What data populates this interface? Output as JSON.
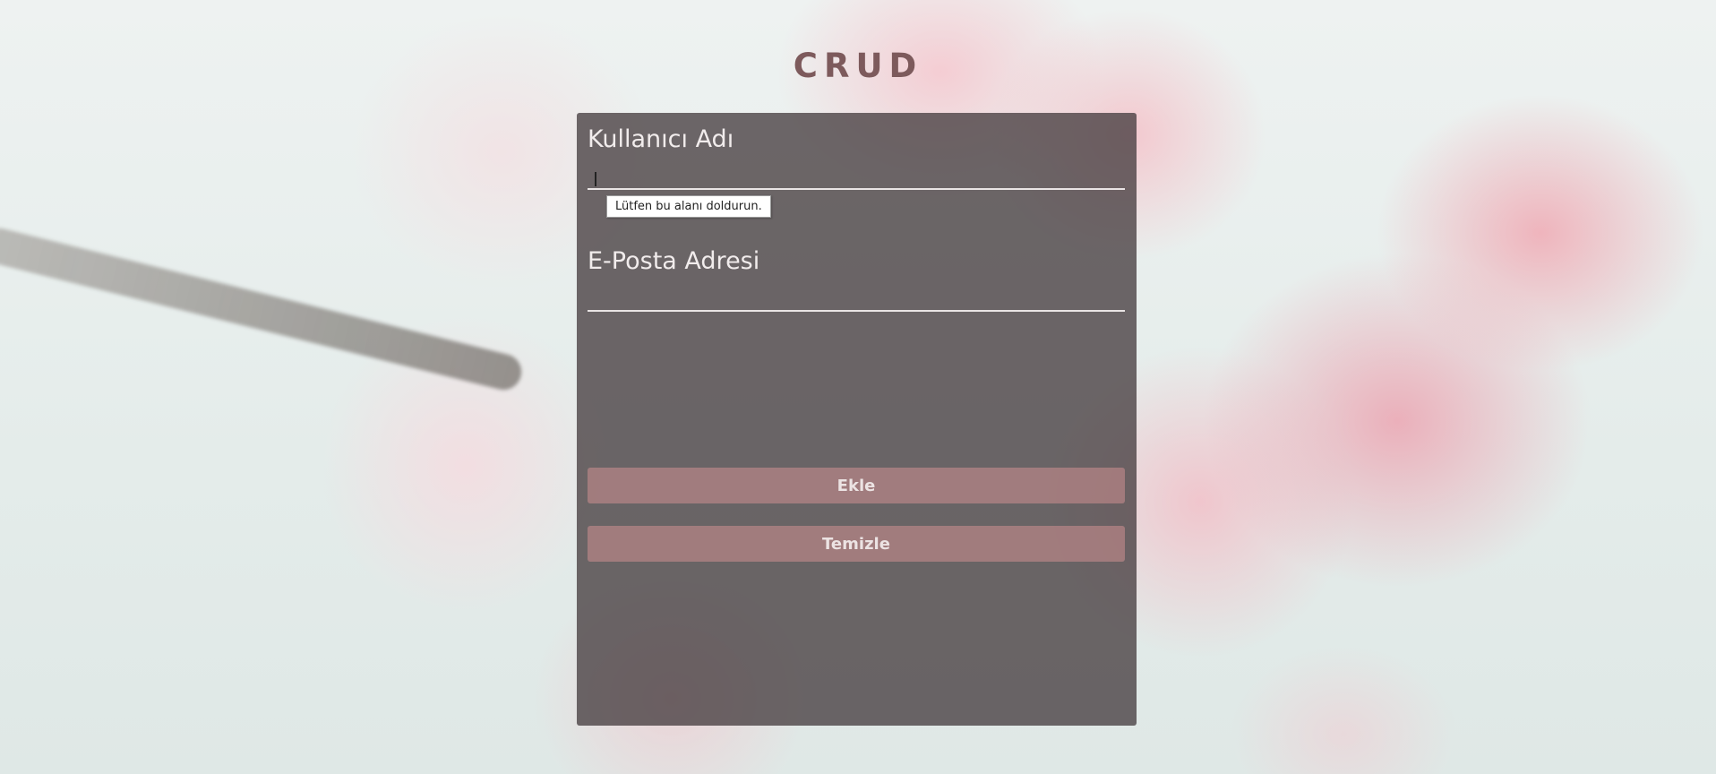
{
  "page": {
    "title": "CRUD"
  },
  "form": {
    "username_label": "Kullanıcı Adı",
    "username_value": "",
    "email_label": "E-Posta Adresi",
    "email_value": "",
    "validation_tooltip": "Lütfen bu alanı doldurun.",
    "add_button": "Ekle",
    "clear_button": "Temizle"
  },
  "colors": {
    "title": "#7d5a5c",
    "panel": "#463e40",
    "button": "#c48a8c",
    "label": "#f1ecec"
  }
}
